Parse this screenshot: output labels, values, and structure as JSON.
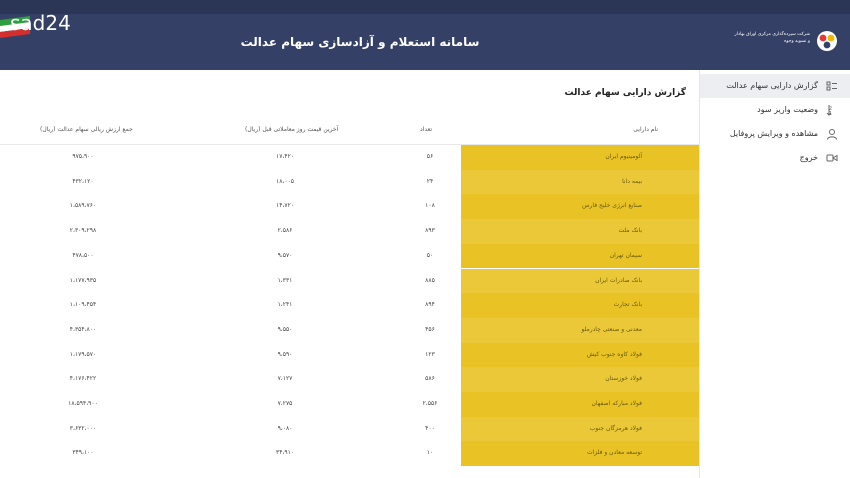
{
  "watermark": "sad24",
  "header": {
    "title": "سامانه استعلام و آزادسازی سهام عدالت",
    "logo_line1": "شرکت سپرده‌گذاری مرکزی اوراق بهادار",
    "logo_line2": "و تسویه وجوه"
  },
  "sidebar": {
    "items": [
      {
        "label": "گزارش دارایی سهام عدالت",
        "icon": "list-icon"
      },
      {
        "label": "وضعیت واریز سود",
        "icon": "sort-icon"
      },
      {
        "label": "مشاهده و ویرایش پروفایل",
        "icon": "user-icon"
      },
      {
        "label": "خروج",
        "icon": "logout-icon"
      }
    ]
  },
  "main": {
    "page_title": "گزارش دارایی سهام عدالت",
    "table": {
      "headers": {
        "name": "نام دارایی",
        "count": "تعداد",
        "price": "آخرین قیمت روز معاملاتی قبل (ریال)",
        "total": "جمع ارزش ریالی سهام عدالت (ریال)"
      },
      "rows": [
        {
          "name": "آلومینیوم ایران",
          "count": "۵۶",
          "price": "۱۷،۴۲۰",
          "total": "۹۷۵،۹۰۰"
        },
        {
          "name": "بیمه دانا",
          "count": "۲۴",
          "price": "۱۸،۰۰۵",
          "total": "۴۳۲،۱۲۰"
        },
        {
          "name": "صنایع انرژی خلیج فارس",
          "count": "۱۰۸",
          "price": "۱۴،۷۲۰",
          "total": "۱،۵۸۹،۷۶۰"
        },
        {
          "name": "بانک ملت",
          "count": "۸۹۳",
          "price": "۲،۵۸۶",
          "total": "۲،۳۰۹،۲۹۸"
        },
        {
          "name": "سیمان تهران",
          "count": "۵۰",
          "price": "۹،۵۷۰",
          "total": "۴۷۸،۵۰۰"
        },
        {
          "name": "بانک صادرات ایران",
          "count": "۸۸۵",
          "price": "۱،۳۳۱",
          "total": "۱،۱۷۷،۹۳۵"
        },
        {
          "name": "بانک تجارت",
          "count": "۸۹۴",
          "price": "۱،۲۴۱",
          "total": "۱،۱۰۹،۴۵۴"
        },
        {
          "name": "معدنی و صنعتی چادرملو",
          "count": "۴۵۶",
          "price": "۹،۵۵۰",
          "total": "۴،۳۵۴،۸۰۰"
        },
        {
          "name": "فولاد کاوه جنوب کیش",
          "count": "۱۲۳",
          "price": "۹،۵۹۰",
          "total": "۱،۱۷۹،۵۷۰"
        },
        {
          "name": "فولاد خوزستان",
          "count": "۵۸۶",
          "price": "۷،۱۲۷",
          "total": "۴،۱۷۶،۴۲۲"
        },
        {
          "name": "فولاد مبارکه اصفهان",
          "count": "۲،۵۵۶",
          "price": "۷،۲۷۵",
          "total": "۱۸،۵۹۴،۹۰۰"
        },
        {
          "name": "فولاد هرمزگان جنوب",
          "count": "۴۰۰",
          "price": "۹،۰۸۰",
          "total": "۳،۶۳۲،۰۰۰"
        },
        {
          "name": "توسعه معادن و فلزات",
          "count": "۱۰",
          "price": "۳۴،۹۱۰",
          "total": "۳۴۹،۱۰۰"
        }
      ]
    }
  },
  "colors": {
    "header_bg": "#344066",
    "name_cell": "#e9c325",
    "sidebar_active": "#eceef2"
  }
}
